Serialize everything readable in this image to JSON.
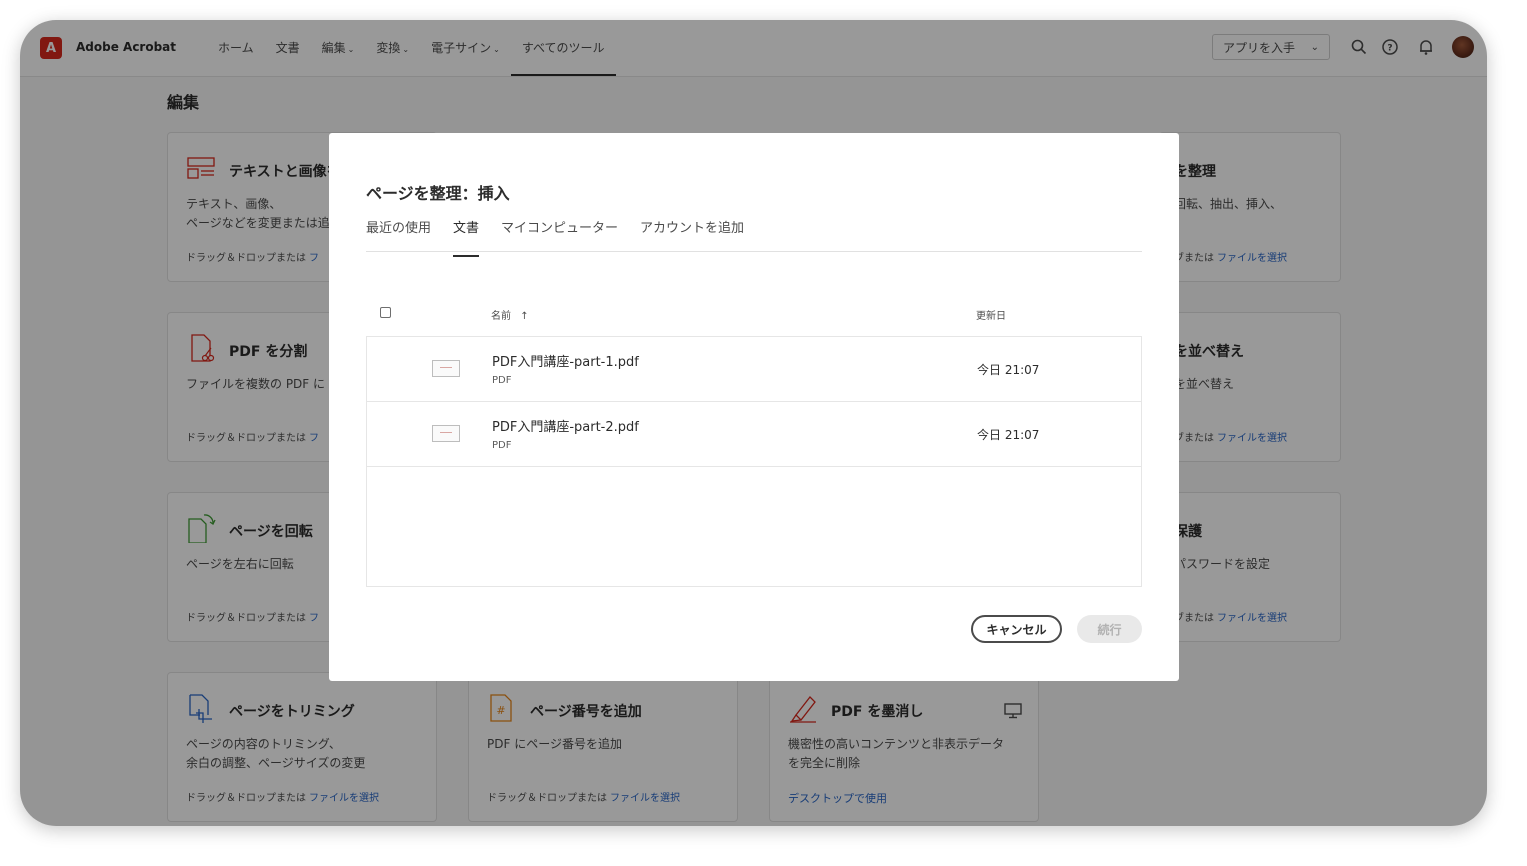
{
  "app": {
    "logo_glyph": "A",
    "title": "Adobe Acrobat"
  },
  "nav": [
    {
      "label": "ホーム",
      "has_menu": false
    },
    {
      "label": "文書",
      "has_menu": false
    },
    {
      "label": "編集",
      "has_menu": true
    },
    {
      "label": "変換",
      "has_menu": true
    },
    {
      "label": "電子サイン",
      "has_menu": true
    },
    {
      "label": "すべてのツール",
      "has_menu": false,
      "active": true
    }
  ],
  "header": {
    "get_app_label": "アプリを入手",
    "icons": [
      "search-icon",
      "help-icon",
      "bell-icon",
      "avatar"
    ]
  },
  "section": {
    "title": "編集"
  },
  "cards": {
    "edit_text": {
      "title": "テキストと画像を",
      "desc": "テキスト、画像、\nページなどを変更または追",
      "drop": "ドラッグ＆ドロップまたは",
      "link": "フ"
    },
    "split": {
      "title": "PDF を分割",
      "desc": "ファイルを複数の PDF に",
      "drop": "ドラッグ＆ドロップまたは",
      "link": "フ"
    },
    "rotate": {
      "title": "ページを回転",
      "desc": "ページを左右に回転",
      "drop": "ドラッグ＆ドロップまたは",
      "link": "フ"
    },
    "crop": {
      "title": "ページをトリミング",
      "desc": "ページの内容のトリミング、\n余白の調整、ページサイズの変更",
      "drop": "ドラッグ＆ドロップまたは",
      "link": "ファイルを選択"
    },
    "page_numbers": {
      "title": "ページ番号を追加",
      "desc": "PDF にページ番号を追加",
      "drop": "ドラッグ＆ドロップまたは",
      "link": "ファイルを選択"
    },
    "redact": {
      "title": "PDF を墨消し",
      "desc": "機密性の高いコンテンツと非表示データ\nを完全に削除",
      "desktop_link": "デスクトップで使用"
    },
    "organize": {
      "title": "を整理",
      "desc": "回転、抽出、挿入、",
      "drop": "ブまたは",
      "link": "ファイルを選択"
    },
    "reorder": {
      "title": "を並べ替え",
      "desc": "を並べ替え",
      "drop": "ブまたは",
      "link": "ファイルを選択"
    },
    "protect": {
      "title": "保護",
      "desc": "パスワードを設定",
      "drop": "ブまたは",
      "link": "ファイルを選択"
    }
  },
  "modal": {
    "title": "ページを整理：挿入",
    "tabs": [
      {
        "label": "最近の使用"
      },
      {
        "label": "文書",
        "active": true
      },
      {
        "label": "マイコンピューター"
      },
      {
        "label": "アカウントを追加"
      }
    ],
    "columns": {
      "name": "名前",
      "sort_arrow": "↑",
      "modified": "更新日"
    },
    "files": [
      {
        "name": "PDF入門講座-part-1.pdf",
        "type": "PDF",
        "modified": "今日 21:07"
      },
      {
        "name": "PDF入門講座-part-2.pdf",
        "type": "PDF",
        "modified": "今日 21:07"
      }
    ],
    "cancel_label": "キャンセル",
    "continue_label": "続行"
  }
}
